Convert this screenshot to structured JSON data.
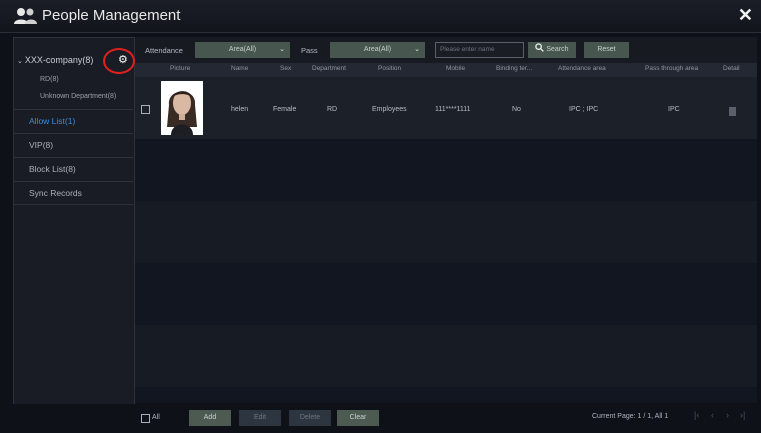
{
  "window": {
    "title": "People Management",
    "close_label": "✕"
  },
  "sidebar": {
    "tree": {
      "root_label": "XXX-company(8)",
      "children": [
        "RD(8)",
        "Unknown Department(8)"
      ]
    },
    "nav_items": [
      {
        "label": "Allow List(1)",
        "active": true
      },
      {
        "label": "VIP(8)",
        "active": false
      },
      {
        "label": "Block List(8)",
        "active": false
      },
      {
        "label": "Sync Records",
        "active": false
      }
    ]
  },
  "filters": {
    "attendance_label": "Attendance",
    "attendance_value": "Area(All)",
    "pass_label": "Pass",
    "pass_value": "Area(All)",
    "search_placeholder": "Please enter name",
    "search_button": "Search",
    "reset_button": "Reset"
  },
  "table": {
    "columns": [
      "Picture",
      "Name",
      "Sex",
      "Department",
      "Position",
      "Mobile",
      "Binding ter...",
      "Attendance area",
      "Pass through area",
      "Detail"
    ],
    "rows": [
      {
        "name": "helen",
        "sex": "Female",
        "department": "RD",
        "position": "Employees",
        "mobile": "111****1111",
        "binding": "No",
        "attendance_area": "IPC ; IPC",
        "pass_area": "IPC"
      }
    ]
  },
  "footer": {
    "all_label": "All",
    "add": "Add",
    "edit": "Edit",
    "delete": "Delete",
    "clear": "Clear",
    "page_info": "Current Page: 1 / 1, All 1"
  },
  "icons": {
    "gear": "gear-icon",
    "people": "people-icon",
    "search": "search-icon",
    "detail": "document-icon"
  },
  "colors": {
    "accent": "#3c8dde",
    "highlight_ring": "#e0201c",
    "button": "#47564f"
  }
}
